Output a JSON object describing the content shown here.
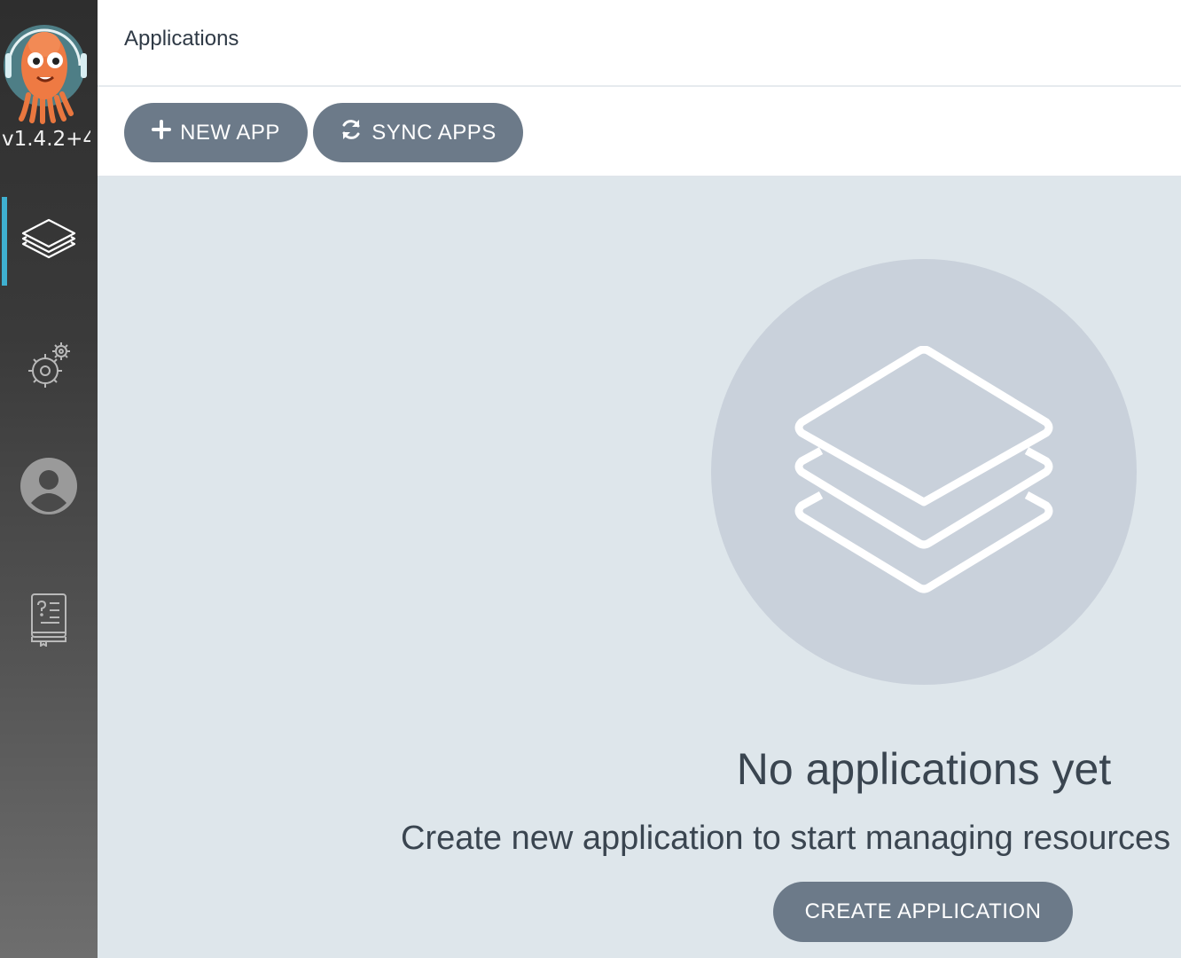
{
  "sidebar": {
    "logo": "argo-octopus-logo",
    "version": "v1.4.2+4",
    "items": [
      {
        "name": "applications",
        "icon": "layers-icon",
        "active": true
      },
      {
        "name": "settings",
        "icon": "gears-icon",
        "active": false
      },
      {
        "name": "user-info",
        "icon": "user-avatar-icon",
        "active": false
      },
      {
        "name": "documentation",
        "icon": "help-book-icon",
        "active": false
      }
    ]
  },
  "header": {
    "title": "Applications"
  },
  "toolbar": {
    "new_app_label": "NEW APP",
    "sync_apps_label": "SYNC APPS"
  },
  "empty_state": {
    "icon": "layers-icon",
    "title": "No applications yet",
    "subtitle": "Create new application to start managing resources in your cluster",
    "create_label": "CREATE APPLICATION"
  },
  "colors": {
    "accent": "#3fb0d0",
    "button": "#6c7a89",
    "background": "#dee6eb",
    "circle": "#c9d1db"
  }
}
